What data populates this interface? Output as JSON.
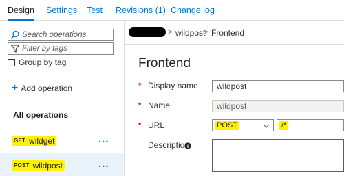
{
  "tabs": [
    {
      "label": "Design",
      "active": true
    },
    {
      "label": "Settings",
      "active": false
    },
    {
      "label": "Test",
      "active": false
    },
    {
      "label": "Revisions (1)",
      "active": false
    },
    {
      "label": "Change log",
      "active": false
    }
  ],
  "sidebar": {
    "search_placeholder": "Search operations",
    "filter_placeholder": "Filter by tags",
    "group_by_tag_label": "Group by tag",
    "group_by_tag_checked": false,
    "add_operation_label": "Add operation",
    "all_operations_label": "All operations",
    "operations": [
      {
        "method": "GET",
        "name": "wildget",
        "selected": false,
        "more": "..."
      },
      {
        "method": "POST",
        "name": "wildpost",
        "selected": true,
        "more": "..."
      }
    ]
  },
  "breadcrumb": {
    "separator": ">",
    "items": [
      "wildpost",
      "Frontend"
    ]
  },
  "form": {
    "title": "Frontend",
    "required_mark": "*",
    "display_name_label": "Display name",
    "display_name_value": "wildpost",
    "name_label": "Name",
    "name_value": "wildpost",
    "url_label": "URL",
    "url_method": "POST",
    "url_template": "/*",
    "description_label": "Description",
    "description_value": ""
  },
  "colors": {
    "accent": "#0078d4",
    "highlight": "#fff200",
    "selected_row": "#eaf3fb",
    "required": "#c50f1f",
    "redaction": "#000000"
  }
}
